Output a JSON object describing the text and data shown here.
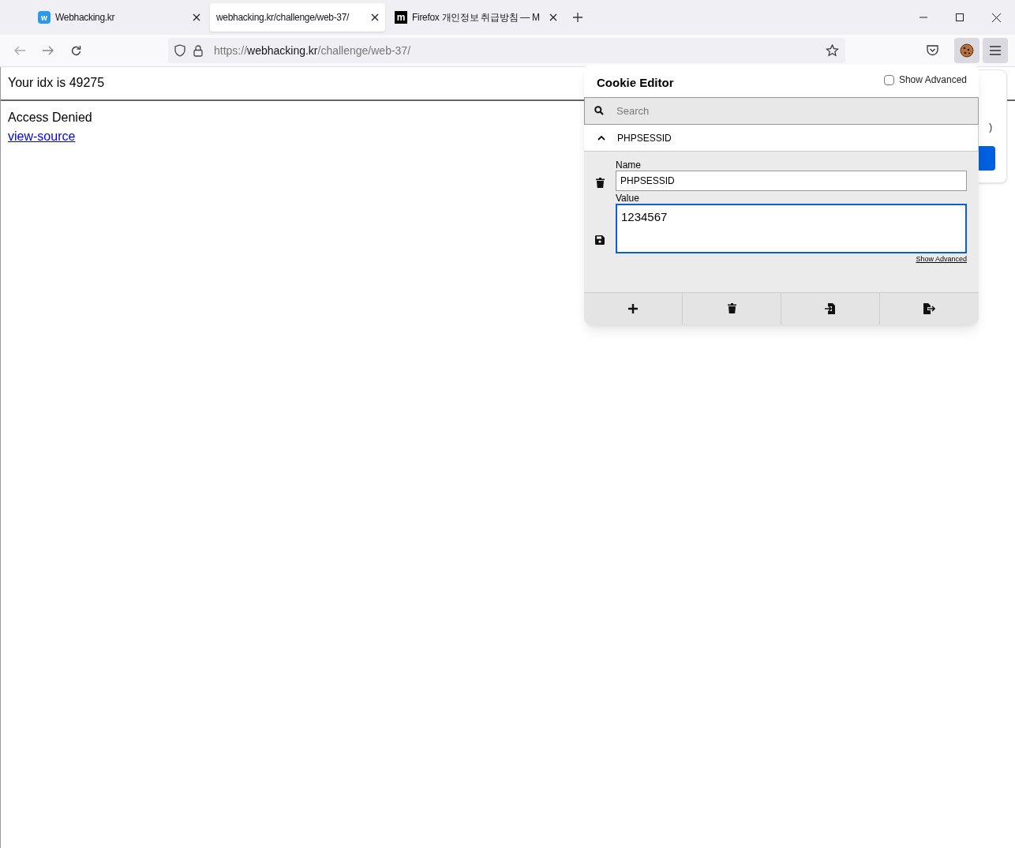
{
  "tabs": [
    {
      "title": "Webhacking.kr",
      "icon": "w",
      "selected": false
    },
    {
      "title": "webhacking.kr/challenge/web-37/",
      "selected": true
    },
    {
      "title": "Firefox 개인정보 취급방침 — M",
      "icon": "m",
      "selected": false
    }
  ],
  "url": {
    "scheme": "https://",
    "host": "webhacking.kr",
    "path": "/challenge/web-37/"
  },
  "page": {
    "idx_line": "Your idx is 49275",
    "message": "Access Denied",
    "link": "view-source"
  },
  "behind_panel": {
    "text": ")"
  },
  "cookie_editor": {
    "title": "Cookie Editor",
    "show_advanced_label": "Show Advanced",
    "show_advanced_checked": false,
    "search_placeholder": "Search",
    "cookie": {
      "name": "PHPSESSID",
      "expanded": true,
      "name_label": "Name",
      "name_value": "PHPSESSID",
      "value_label": "Value",
      "value": "1234567",
      "advanced_link": "Show Advanced"
    }
  }
}
